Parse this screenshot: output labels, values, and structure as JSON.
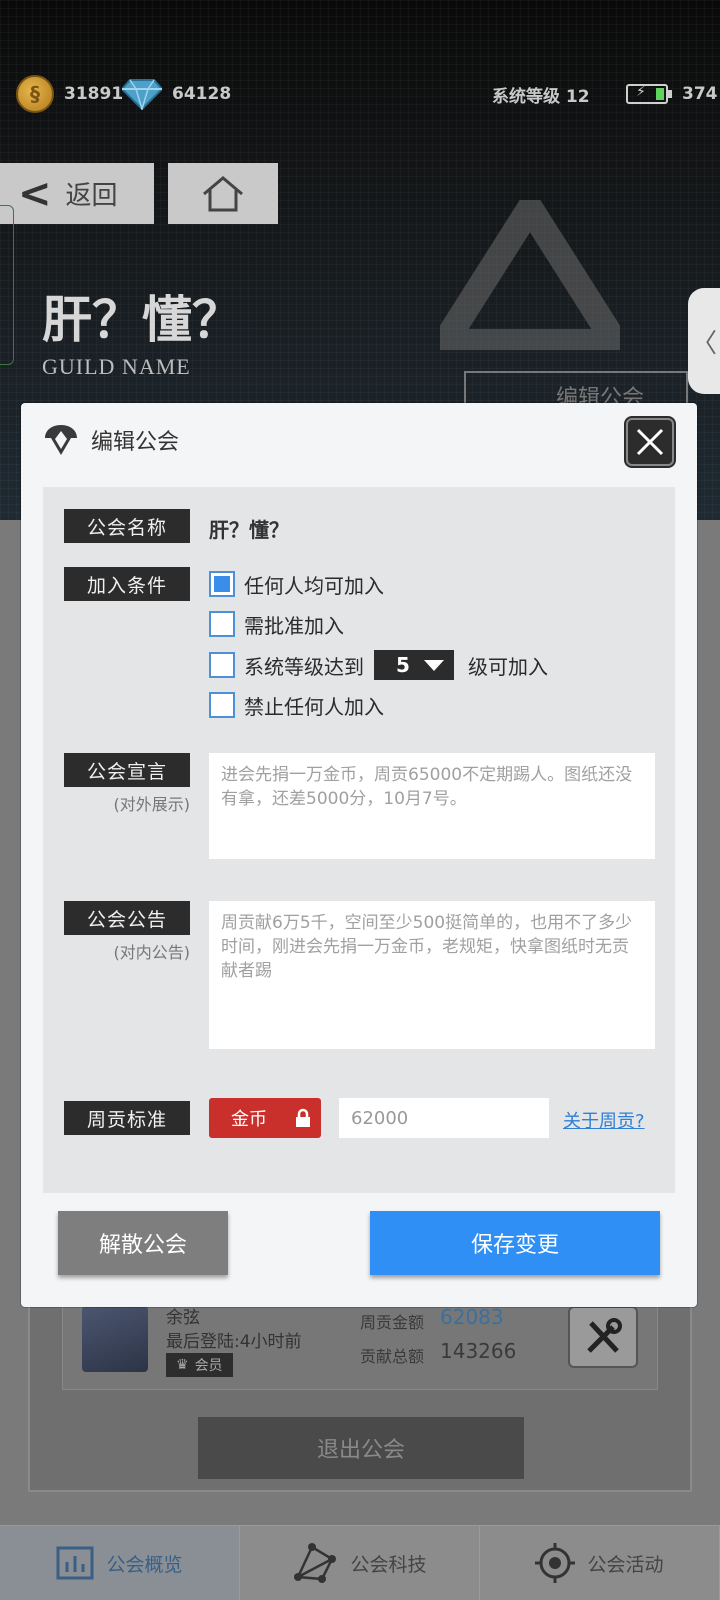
{
  "status": {
    "gold": "31891",
    "diamonds": "64128",
    "system_level": "系统等级 12",
    "energy": "374"
  },
  "header": {
    "back_label": "返回",
    "guild_name": "肝？懂？",
    "guild_name_en": "GUILD NAME",
    "edit_guild_label": "编辑公会"
  },
  "modal": {
    "title": "编辑公会",
    "fields": {
      "name_label": "公会名称",
      "name_value": "肝？懂？",
      "join_label": "加入条件",
      "options": {
        "anyone": "任何人均可加入",
        "approval": "需批准加入",
        "level_prefix": "系统等级达到",
        "level_value": "5",
        "level_suffix": "级可加入",
        "forbid": "禁止任何人加入"
      },
      "declaration_label": "公会宣言",
      "declaration_sub": "(对外展示)",
      "declaration_text": "进会先捐一万金币，周贡65000不定期踢人。图纸还没有拿，还差5000分，10月7号。",
      "notice_label": "公会公告",
      "notice_sub": "(对内公告)",
      "notice_text": "周贡献6万5千，空间至少500挺简单的，也用不了多少时间，刚进会先捐一万金币，老规矩，快拿图纸时无贡献者踢",
      "weekly_label": "周贡标准",
      "currency": "金币",
      "weekly_amount": "62000",
      "about_link": "关于周贡?"
    },
    "disband_label": "解散公会",
    "save_label": "保存变更"
  },
  "member": {
    "name": "余弦",
    "last_login": "最后登陆:4小时前",
    "role": "会员",
    "weekly_key": "周贡金额",
    "weekly_val": "62083",
    "total_key": "贡献总额",
    "total_val": "143266"
  },
  "quit_label": "退出公会",
  "nav": {
    "overview": "公会概览",
    "tech": "公会科技",
    "activity": "公会活动"
  },
  "colors": {
    "primary": "#2f8ff5",
    "danger": "#c9302c",
    "link": "#2f7fd4"
  }
}
